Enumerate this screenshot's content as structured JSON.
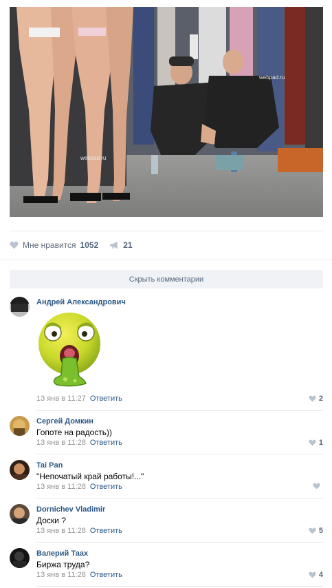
{
  "post": {
    "likes_label": "Мне нравится",
    "likes_count": "1052",
    "shares_count": "21",
    "photo_watermarks": [
      "webpad.ru",
      "webpad.ru"
    ]
  },
  "hide_comments_label": "Скрыть комментарии",
  "comments": [
    {
      "author": "Андрей Александрович",
      "text": "",
      "sticker": "vomiting-smiley",
      "time": "13 янв в 11:27",
      "reply": "Ответить",
      "likes": "2"
    },
    {
      "author": "Сергей Домкин",
      "text": "Гопоте на радость))",
      "time": "13 янв в 11:28",
      "reply": "Ответить",
      "likes": "1"
    },
    {
      "author": "Tai Pan",
      "text": "\"Непочатый край работы!...\"",
      "time": "13 янв в 11:28",
      "reply": "Ответить",
      "likes": ""
    },
    {
      "author": "Dornichev Vladimir",
      "text": "Доски ?",
      "time": "13 янв в 11:28",
      "reply": "Ответить",
      "likes": "5"
    },
    {
      "author": "Валерий Таах",
      "text": "Биржа труда?",
      "time": "13 янв в 11:28",
      "reply": "Ответить",
      "likes": "4"
    }
  ],
  "colors": {
    "link": "#2a5885",
    "muted": "#939393",
    "button_bg": "#f0f2f5"
  }
}
